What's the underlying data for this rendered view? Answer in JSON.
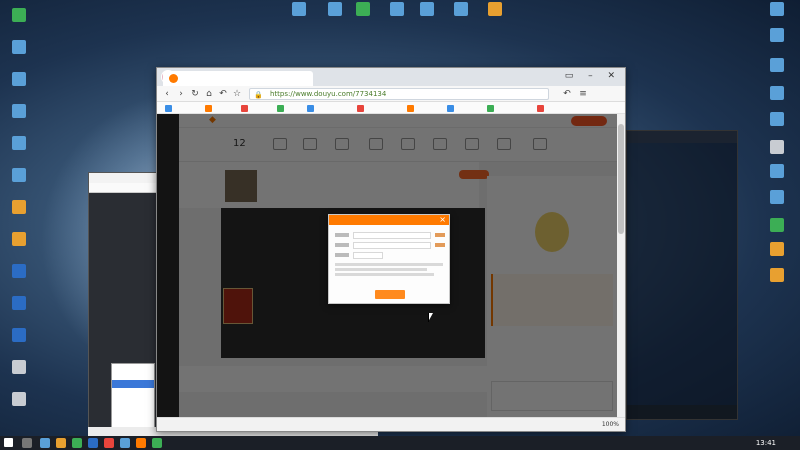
{
  "browser": {
    "url": "https://www.douyu.com/7734134"
  },
  "page": {
    "follower_count": "12"
  },
  "status_bar": {
    "zoom": "100%"
  },
  "taskbar": {
    "time": "13:41"
  },
  "colors": {
    "accent": "#ff7a00",
    "url_green": "#4a7c2a"
  }
}
